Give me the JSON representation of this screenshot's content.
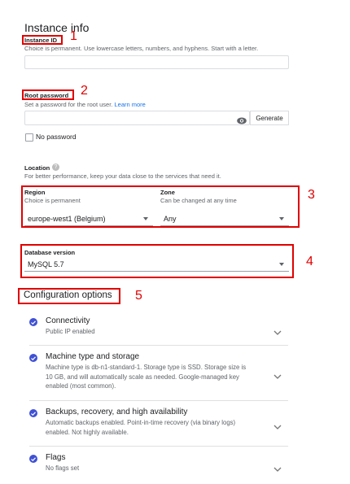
{
  "section_title": "Instance info",
  "instance_id": {
    "label": "Instance ID",
    "help": "Choice is permanent. Use lowercase letters, numbers, and hyphens. Start with a letter.",
    "value": ""
  },
  "root_password": {
    "label": "Root password",
    "help_prefix": "Set a password for the root user.",
    "help_link": "Learn more",
    "value": "",
    "generate_label": "Generate",
    "no_password_label": "No password"
  },
  "location": {
    "label": "Location",
    "help": "For better performance, keep your data close to the services that need it.",
    "region": {
      "label": "Region",
      "help": "Choice is permanent",
      "value": "europe-west1 (Belgium)"
    },
    "zone": {
      "label": "Zone",
      "help": "Can be changed at any time",
      "value": "Any"
    }
  },
  "database_version": {
    "label": "Database version",
    "value": "MySQL 5.7"
  },
  "config": {
    "title": "Configuration options",
    "items": [
      {
        "title": "Connectivity",
        "desc": "Public IP enabled"
      },
      {
        "title": "Machine type and storage",
        "desc": "Machine type is db-n1-standard-1. Storage type is SSD. Storage size is 10 GB, and will automatically scale as needed. Google-managed key enabled (most common)."
      },
      {
        "title": "Backups, recovery, and high availability",
        "desc": "Automatic backups enabled. Point-in-time recovery (via binary logs) enabled. Not highly available."
      },
      {
        "title": "Flags",
        "desc": "No flags set"
      }
    ]
  },
  "annotations": [
    "1",
    "2",
    "3",
    "4",
    "5"
  ],
  "colors": {
    "annotation": "#e00000",
    "check": "#3f51d4",
    "link": "#1a73e8"
  }
}
